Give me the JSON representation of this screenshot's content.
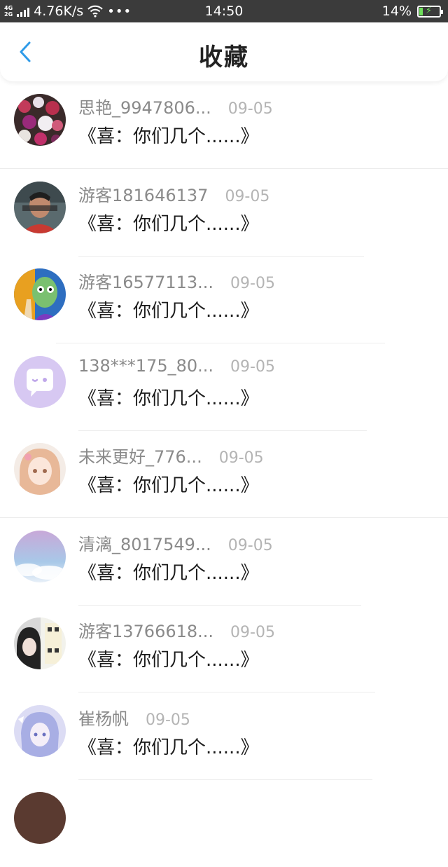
{
  "status_bar": {
    "net_top": "4G",
    "net_bottom": "2G",
    "speed": "4.76K/s",
    "dots": "•••",
    "time": "14:50",
    "battery": "14%"
  },
  "header": {
    "title": "收藏"
  },
  "favorites": [
    {
      "username": "思艳_9947806...",
      "date": "09-05",
      "title": "《喜：你们几个......》"
    },
    {
      "username": "游客181646137",
      "date": "09-05",
      "title": "《喜：你们几个......》"
    },
    {
      "username": "游客16577113...",
      "date": "09-05",
      "title": "《喜：你们几个......》"
    },
    {
      "username": "138***175_80...",
      "date": "09-05",
      "title": "《喜：你们几个......》"
    },
    {
      "username": "未来更好_776...",
      "date": "09-05",
      "title": "《喜：你们几个......》"
    },
    {
      "username": "清漓_8017549...",
      "date": "09-05",
      "title": "《喜：你们几个......》"
    },
    {
      "username": "游客13766618...",
      "date": "09-05",
      "title": "《喜：你们几个......》"
    },
    {
      "username": "崔杨帆",
      "date": "09-05",
      "title": "《喜：你们几个......》"
    }
  ],
  "colors": {
    "accent": "#2f9be8",
    "status_bar_bg": "#3b3b3b"
  }
}
